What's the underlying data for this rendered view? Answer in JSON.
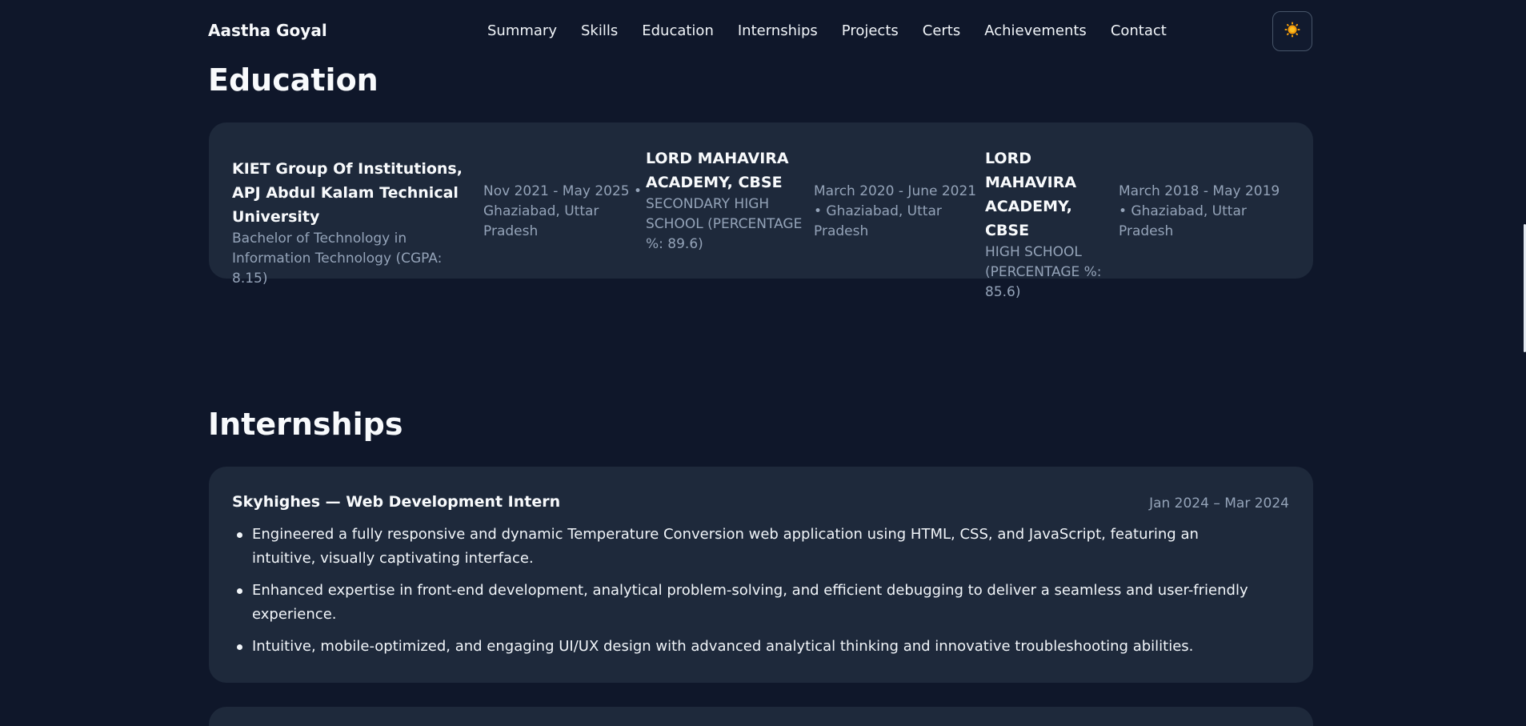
{
  "header": {
    "brand": "Aastha Goyal",
    "nav": [
      "Summary",
      "Skills",
      "Education",
      "Internships",
      "Projects",
      "Certs",
      "Achievements",
      "Contact"
    ],
    "theme_icon": "sun-icon"
  },
  "education": {
    "title": "Education",
    "entries": [
      {
        "name": "KIET Group Of Institutions, APJ Abdul Kalam Technical University",
        "degree": "Bachelor of Technology in Information Technology (CGPA: 8.15)",
        "meta": "Nov 2021 - May 2025 • Ghaziabad, Uttar Pradesh"
      },
      {
        "name": "LORD MAHAVIRA ACADEMY, CBSE",
        "degree": "SECONDARY HIGH SCHOOL (PERCENTAGE %: 89.6)",
        "meta": "March 2020 - June 2021 • Ghaziabad, Uttar Pradesh"
      },
      {
        "name": "LORD MAHAVIRA ACADEMY, CBSE",
        "degree": "HIGH SCHOOL (PERCENTAGE %: 85.6)",
        "meta": "March 2018 - May 2019 • Ghaziabad, Uttar Pradesh"
      }
    ]
  },
  "internships": {
    "title": "Internships",
    "items": [
      {
        "title": "Skyhighes — Web Development Intern",
        "dates": "Jan 2024 – Mar 2024",
        "bullets": [
          "Engineered a fully responsive and dynamic Temperature Conversion web application using HTML, CSS, and JavaScript, featuring an intuitive, visually captivating interface.",
          "Enhanced expertise in front-end development, analytical problem-solving, and efficient debugging to deliver a seamless and user-friendly experience.",
          "Intuitive, mobile-optimized, and engaging UI/UX design with advanced analytical thinking and innovative troubleshooting abilities."
        ]
      }
    ]
  },
  "colors": {
    "background": "#0f172a",
    "card": "#1e293b",
    "muted_text": "#94a3b8",
    "sun": "#f59e0b"
  }
}
